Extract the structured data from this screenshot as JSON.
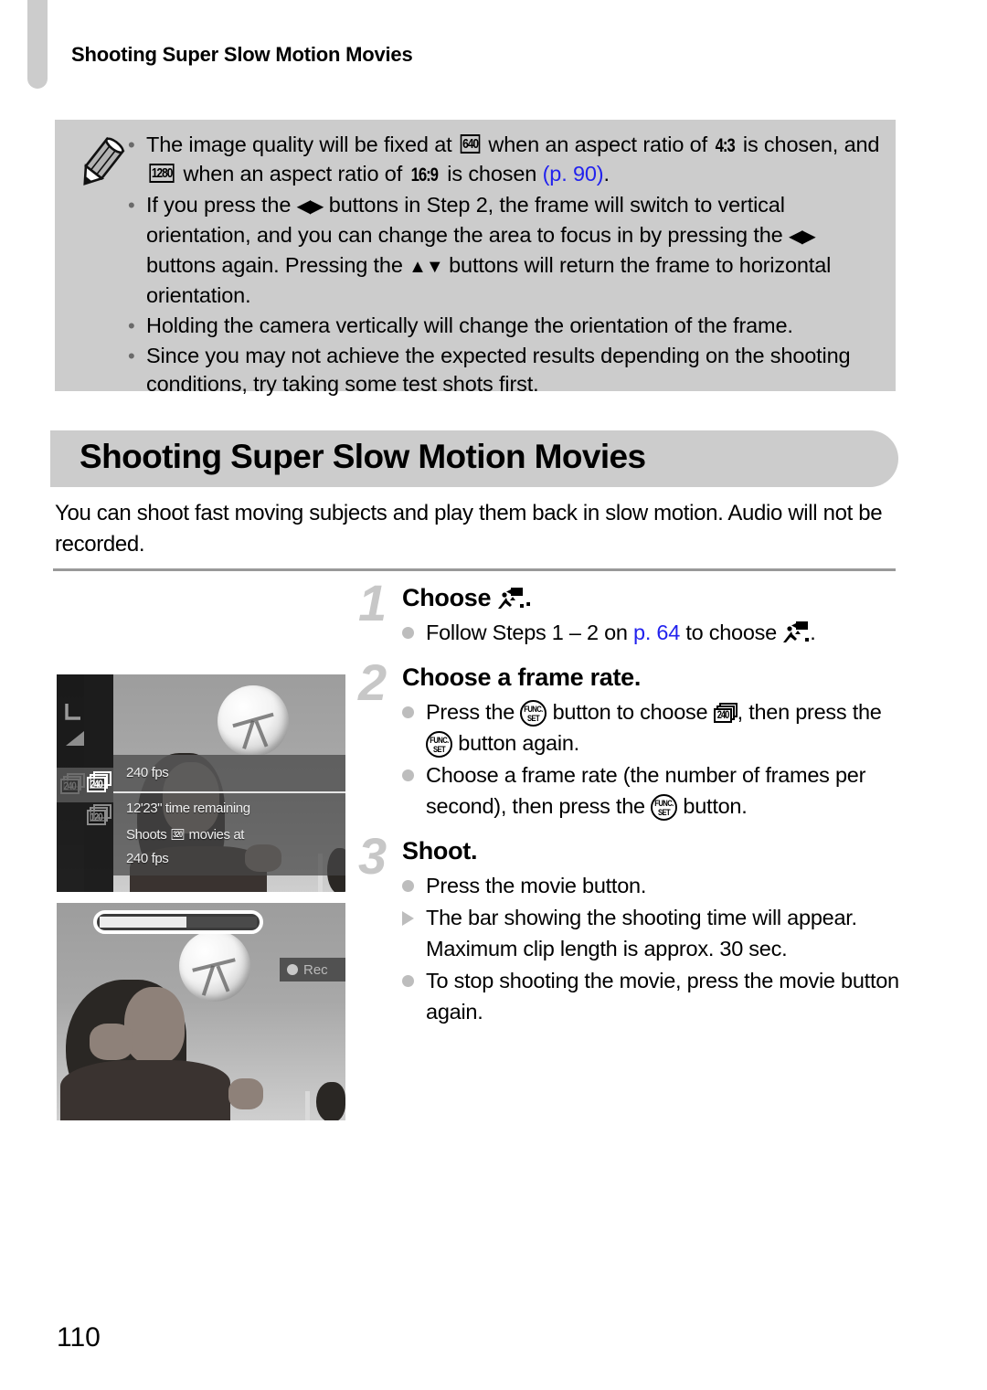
{
  "running_header": "Shooting Super Slow Motion Movies",
  "notes": {
    "icon": "pencil-icon",
    "items": [
      {
        "bullet": "•",
        "segments": [
          {
            "type": "text",
            "value": "The image quality will be fixed at "
          },
          {
            "type": "glyph-box",
            "value": "640"
          },
          {
            "type": "text",
            "value": " when an aspect ratio of "
          },
          {
            "type": "ratio",
            "value": "4:3"
          },
          {
            "type": "text",
            "value": " is chosen, and "
          },
          {
            "type": "glyph-box",
            "value": "1280"
          },
          {
            "type": "text",
            "value": " when an aspect ratio of "
          },
          {
            "type": "ratio",
            "value": "16:9"
          },
          {
            "type": "text",
            "value": " is chosen "
          },
          {
            "type": "link",
            "value": "(p. 90)"
          },
          {
            "type": "text",
            "value": "."
          }
        ]
      },
      {
        "bullet": "•",
        "segments": [
          {
            "type": "text",
            "value": "If you press the "
          },
          {
            "type": "arrows-lr",
            "value": "◀▶"
          },
          {
            "type": "text",
            "value": " buttons in Step 2, the frame will switch to vertical orientation, and you can change the area to focus in by pressing the "
          },
          {
            "type": "arrows-lr",
            "value": "◀▶"
          },
          {
            "type": "text",
            "value": " buttons again. Pressing the "
          },
          {
            "type": "arrows-ud",
            "value": "▲▼"
          },
          {
            "type": "text",
            "value": " buttons will return the frame to horizontal orientation."
          }
        ]
      },
      {
        "bullet": "•",
        "segments": [
          {
            "type": "text",
            "value": "Holding the camera vertically will change the orientation of the frame."
          }
        ]
      },
      {
        "bullet": "•",
        "segments": [
          {
            "type": "text",
            "value": "Since you may not achieve the expected results depending on the shooting conditions, try taking some test shots first."
          }
        ]
      }
    ]
  },
  "section": {
    "title": "Shooting Super Slow Motion Movies",
    "intro": "You can shoot fast moving subjects and play them back in slow motion. Audio will not be recorded."
  },
  "steps": [
    {
      "number": "1",
      "title_segments": [
        {
          "type": "text",
          "value": "Choose "
        },
        {
          "type": "ssm-icon",
          "value": "super-slow-motion-movie-icon"
        },
        {
          "type": "text",
          "value": "."
        }
      ],
      "items": [
        {
          "marker": "dot",
          "segments": [
            {
              "type": "text",
              "value": "Follow Steps 1 – 2 on "
            },
            {
              "type": "link",
              "value": "p. 64"
            },
            {
              "type": "text",
              "value": " to choose "
            },
            {
              "type": "ssm-icon",
              "value": "super-slow-motion-movie-icon"
            },
            {
              "type": "text",
              "value": "."
            }
          ]
        }
      ]
    },
    {
      "number": "2",
      "title_segments": [
        {
          "type": "text",
          "value": "Choose a frame rate."
        }
      ],
      "items": [
        {
          "marker": "dot",
          "segments": [
            {
              "type": "text",
              "value": "Press the "
            },
            {
              "type": "func-set",
              "value": "FUNC./SET"
            },
            {
              "type": "text",
              "value": " button to choose "
            },
            {
              "type": "fr-glyph",
              "value": "240"
            },
            {
              "type": "text",
              "value": ", then press the "
            },
            {
              "type": "func-set",
              "value": "FUNC./SET"
            },
            {
              "type": "text",
              "value": " button again."
            }
          ]
        },
        {
          "marker": "dot",
          "segments": [
            {
              "type": "text",
              "value": "Choose a frame rate (the number of frames per second), then press the "
            },
            {
              "type": "func-set",
              "value": "FUNC./SET"
            },
            {
              "type": "text",
              "value": " button."
            }
          ]
        }
      ]
    },
    {
      "number": "3",
      "title_segments": [
        {
          "type": "text",
          "value": "Shoot."
        }
      ],
      "items": [
        {
          "marker": "dot",
          "segments": [
            {
              "type": "text",
              "value": "Press the movie button."
            }
          ]
        },
        {
          "marker": "triangle",
          "segments": [
            {
              "type": "text",
              "value": "The bar showing the shooting time will appear. Maximum clip length is approx. 30 sec."
            }
          ]
        },
        {
          "marker": "dot",
          "segments": [
            {
              "type": "text",
              "value": "To stop shooting the movie, press the movie button again."
            }
          ]
        }
      ]
    }
  ],
  "lcd_screens": [
    {
      "name": "frame-rate-menu-screen",
      "rail_icons": [
        "L",
        "quality-icon"
      ],
      "rail_selection": {
        "selected": "240",
        "other": "120",
        "left_preview": "240"
      },
      "menu": {
        "row1": "240 fps",
        "time_remaining": "12'23\" time remaining",
        "description_pre": "Shoots ",
        "description_glyph": "320",
        "description_mid": " movies at",
        "description_post": "240 fps"
      }
    },
    {
      "name": "recording-screen",
      "progress_percent": 55,
      "rec_label": "Rec"
    }
  ],
  "page_number": "110",
  "colors": {
    "panel_gray": "#cccccc",
    "link_blue": "#2222ee",
    "step_number_gray": "#c7c7c7",
    "marker_gray": "#bdbdbd",
    "separator_gray": "#999999"
  }
}
